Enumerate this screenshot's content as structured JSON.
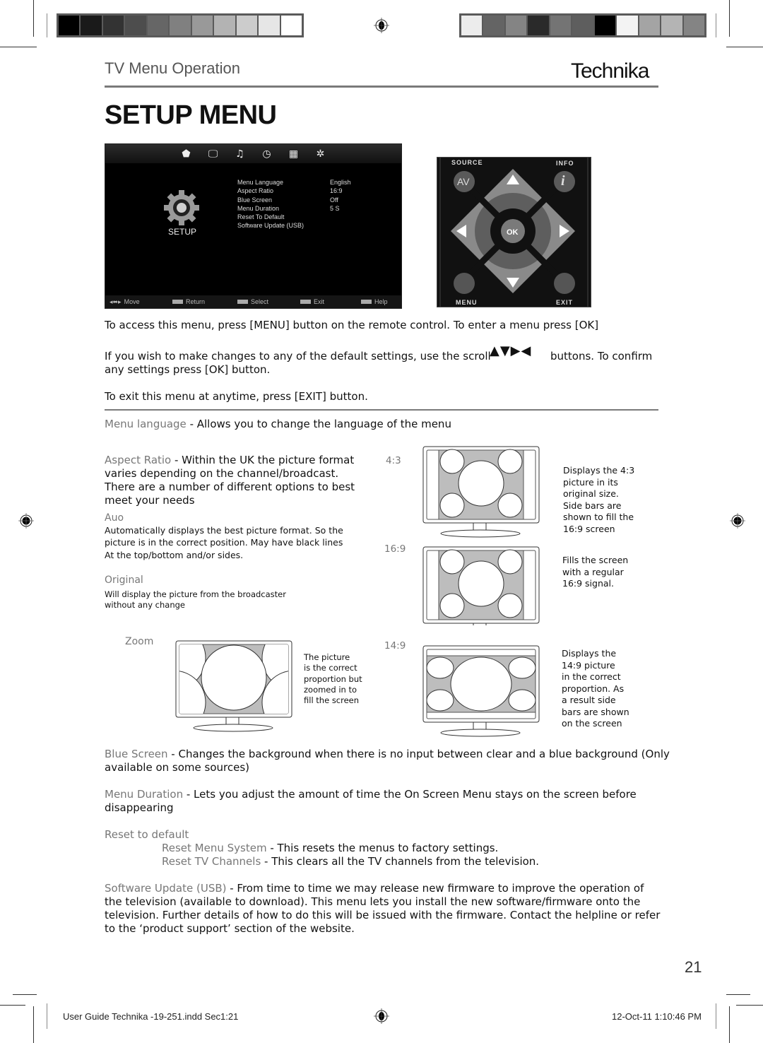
{
  "header": {
    "section_title": "TV Menu Operation",
    "brand": "Technika",
    "page_title": "SETUP MENU"
  },
  "color_bars": {
    "left": [
      "#000000",
      "#1a1a1a",
      "#333333",
      "#4d4d4d",
      "#666666",
      "#808080",
      "#999999",
      "#b3b3b3",
      "#cccccc",
      "#e6e6e6",
      "#ffffff"
    ],
    "right": [
      "#ececec",
      "#646464",
      "#848484",
      "#2a2a2a",
      "#747474",
      "#5e5e5e",
      "#000000",
      "#f3f3f3",
      "#a4a4a4",
      "#b4b4b4",
      "#848484"
    ]
  },
  "tv_menu": {
    "top_icons": [
      "tv-channel-icon",
      "picture-icon",
      "sound-icon",
      "clock-icon",
      "lock-grid-icon",
      "setup-gear-icon"
    ],
    "top_glyphs": [
      "⬟",
      "🖵",
      "♫",
      "◷",
      "▦",
      "✲"
    ],
    "category_label": "SETUP",
    "items": [
      {
        "label": "Menu Language",
        "value": "English"
      },
      {
        "label": "Aspect Ratio",
        "value": "16:9"
      },
      {
        "label": "Blue Screen",
        "value": "Off"
      },
      {
        "label": "Menu Duration",
        "value": "5 S"
      },
      {
        "label": "Reset To Default",
        "value": ""
      },
      {
        "label": "Software Update (USB)",
        "value": ""
      }
    ],
    "footer": [
      {
        "key": "◂⬌▸",
        "label": "Move"
      },
      {
        "key": "MENU",
        "label": "Return"
      },
      {
        "key": "OK",
        "label": "Select"
      },
      {
        "key": "EXIT",
        "label": "Exit"
      },
      {
        "key": "INFO",
        "label": "Help"
      }
    ]
  },
  "remote": {
    "source_label": "SOURCE",
    "info_label": "INFO",
    "av_label": "AV",
    "info_glyph": "i",
    "ok_label": "OK",
    "menu_label": "MENU",
    "exit_label": "EXIT"
  },
  "intro": {
    "line1": "To access this menu, press [MENU] button on the remote control. To enter a menu press [OK]",
    "line2_a": "If you wish to make changes to any of the default settings, use the scroll",
    "line2_arrows": "▲▼▶◀",
    "line2_b": "buttons. To confirm",
    "line2_c": "any settings press [OK] button.",
    "line3": "To exit this menu at anytime, press [EXIT] button."
  },
  "sections": {
    "menu_language": {
      "term": "Menu language",
      "desc": " - Allows you to change the language of the menu"
    },
    "aspect_ratio": {
      "term": "Aspect Ratio",
      "desc_l1": " - Within the UK the picture format",
      "desc_l2": "varies depending on the channel/broadcast.",
      "desc_l3": "There are a number of different options to best",
      "desc_l4": "meet your needs",
      "auto_term": "Auo",
      "auto_l1": "Automatically displays the best picture format. So the",
      "auto_l2": "picture is in the correct position. May have black lines",
      "auto_l3": "At the top/bottom and/or sides.",
      "original_term": "Original",
      "original_l1": "Will display the picture from the broadcaster",
      "original_l2": "without any change",
      "zoom_term": "Zoom",
      "zoom_desc": [
        "The picture",
        "is the correct",
        "proportion but",
        "zoomed in to",
        "fill the screen"
      ],
      "r43_label": "4:3",
      "r43_desc": [
        "Displays the 4:3",
        "picture in its",
        "original size.",
        "Side bars are",
        "shown to fill the",
        "16:9 screen"
      ],
      "r169_label": "16:9",
      "r169_desc": [
        "Fills the screen",
        "with a regular",
        "16:9 signal."
      ],
      "r149_label": "14:9",
      "r149_desc": [
        "Displays the",
        "14:9 picture",
        "in the correct",
        "proportion. As",
        "a result side",
        "bars are shown",
        "on the screen"
      ]
    },
    "blue_screen": {
      "term": "Blue Screen",
      "desc_l1": " - Changes the background when there is no input between clear and a blue background (Only",
      "desc_l2": "available on some sources)"
    },
    "menu_duration": {
      "term": "Menu Duration",
      "desc_l1": " - Lets you adjust the amount of time the On Screen Menu stays on the screen before",
      "desc_l2": "disappearing"
    },
    "reset": {
      "term": "Reset to default",
      "menu_term": "Reset Menu System",
      "menu_desc": " - This resets the menus to factory settings.",
      "tv_term": "Reset TV Channels",
      "tv_desc": " - This clears all the TV channels from the television."
    },
    "software_update": {
      "term": "Software Update (USB)",
      "desc_l1": " - From time to time we may release new firmware to improve the operation of",
      "desc_l2": "the television (available to download). This menu lets you install the new software/firmware onto the",
      "desc_l3": "television. Further details of how to do this will be issued with the firmware. Contact the helpline or refer",
      "desc_l4": "to the ‘product support’ section of the website."
    }
  },
  "page_number": "21",
  "print_footer": {
    "file": "User Guide Technika -19-251.indd   Sec1:21",
    "datetime": "12-Oct-11   1:10:46 PM"
  }
}
